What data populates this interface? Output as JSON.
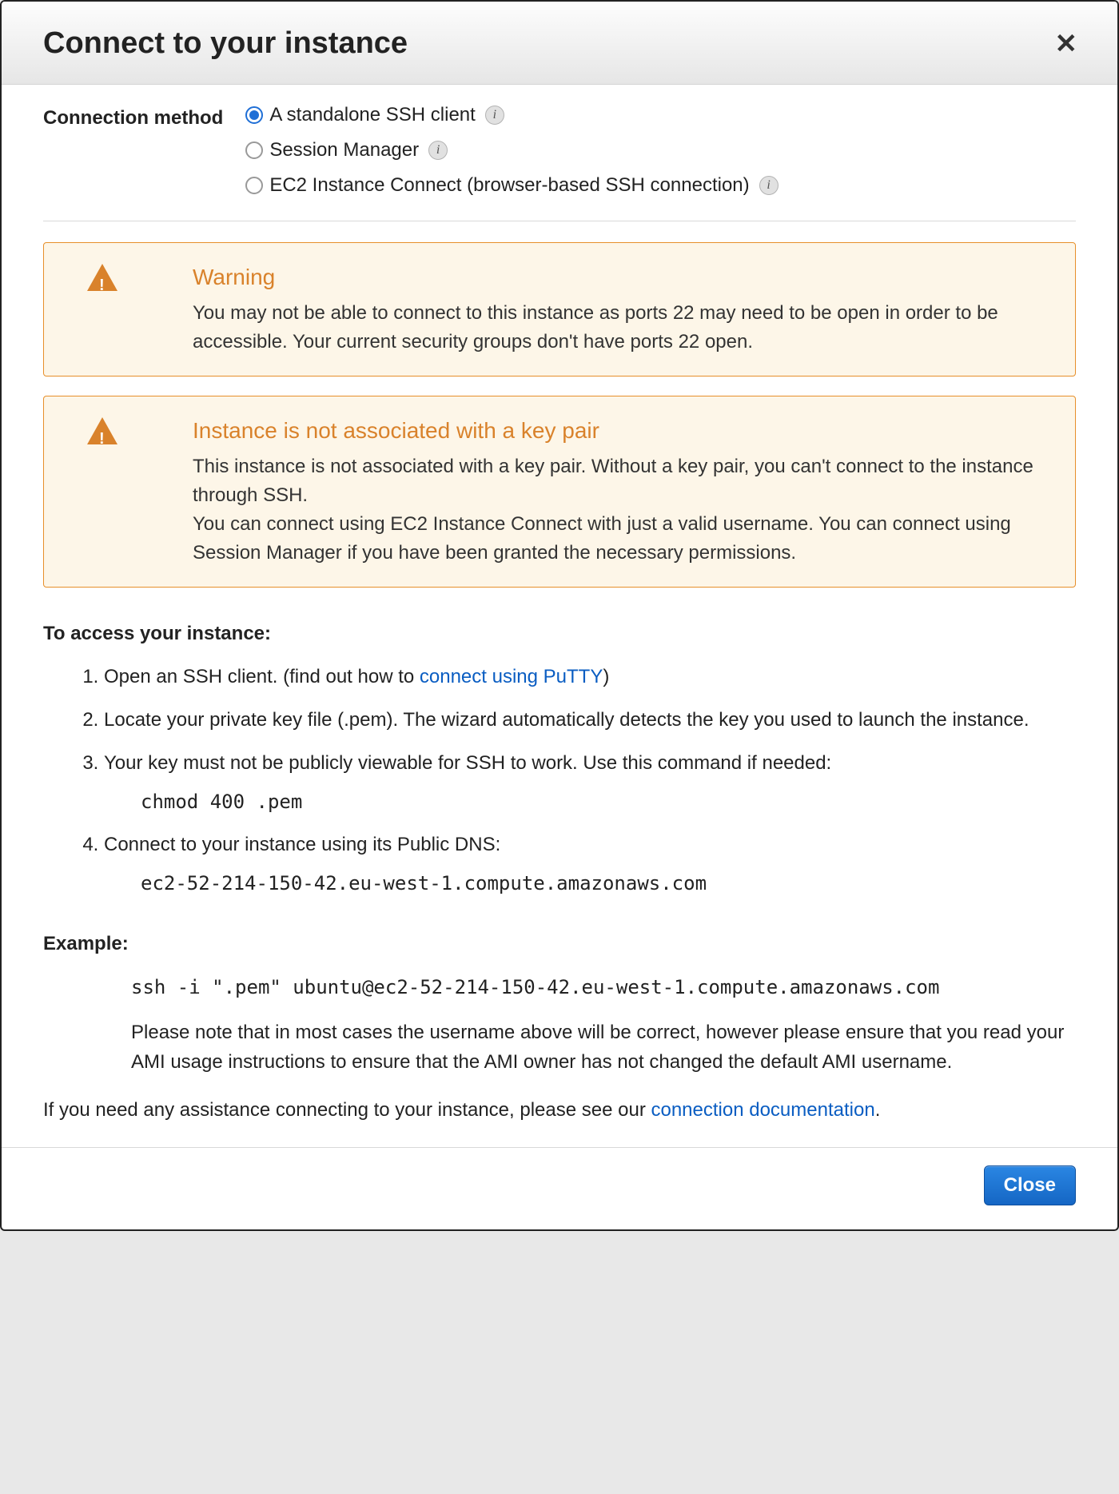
{
  "header": {
    "title": "Connect to your instance",
    "close_glyph": "✕"
  },
  "connection_method": {
    "label": "Connection method",
    "options": [
      {
        "label": "A standalone SSH client",
        "selected": true
      },
      {
        "label": "Session Manager",
        "selected": false
      },
      {
        "label": "EC2 Instance Connect (browser-based SSH connection)",
        "selected": false
      }
    ]
  },
  "alerts": [
    {
      "title": "Warning",
      "body": "You may not be able to connect to this instance as ports 22 may need to be open in order to be accessible. Your current security groups don't have ports 22 open."
    },
    {
      "title": "Instance is not associated with a key pair",
      "body": "This instance is not associated with a key pair. Without a key pair, you can't connect to the instance through SSH.\nYou can connect using EC2 Instance Connect with just a valid username. You can connect using Session Manager if you have been granted the necessary permissions."
    }
  ],
  "access": {
    "heading": "To access your instance:",
    "step1_prefix": "Open an SSH client. (find out how to ",
    "step1_link": "connect using PuTTY",
    "step1_suffix": ")",
    "step2": "Locate your private key file (.pem). The wizard automatically detects the key you used to launch the instance.",
    "step3": "Your key must not be publicly viewable for SSH to work. Use this command if needed:",
    "step3_code": "chmod 400 .pem",
    "step4": "Connect to your instance using its Public DNS:",
    "step4_code": "ec2-52-214-150-42.eu-west-1.compute.amazonaws.com"
  },
  "example": {
    "heading": "Example:",
    "code": "ssh -i \".pem\" ubuntu@ec2-52-214-150-42.eu-west-1.compute.amazonaws.com",
    "note": "Please note that in most cases the username above will be correct, however please ensure that you read your AMI usage instructions to ensure that the AMI owner has not changed the default AMI username."
  },
  "assist": {
    "prefix": "If you need any assistance connecting to your instance, please see our ",
    "link": "connection documentation",
    "suffix": "."
  },
  "footer": {
    "close": "Close"
  },
  "info_glyph": "i"
}
